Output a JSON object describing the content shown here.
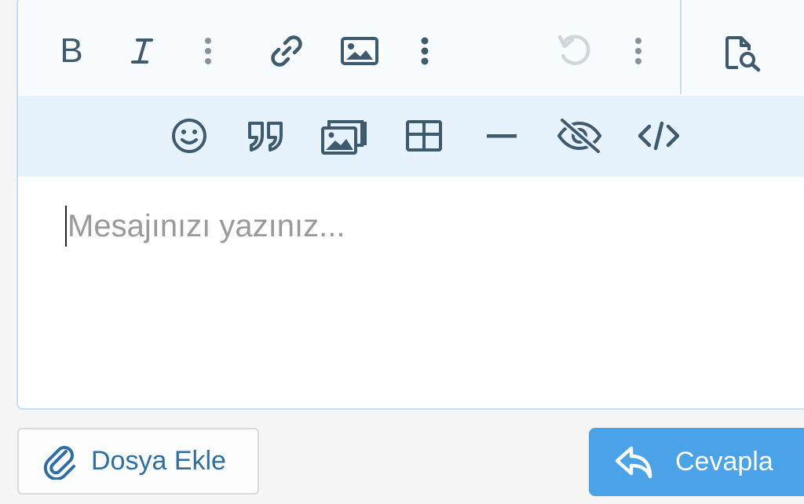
{
  "editor": {
    "placeholder": "Mesajınızı yazınız...",
    "toolbar_top": [
      {
        "name": "bold-icon"
      },
      {
        "name": "italic-icon"
      },
      {
        "name": "more-vertical-icon"
      },
      {
        "name": "link-icon"
      },
      {
        "name": "image-icon"
      },
      {
        "name": "more-vertical-icon"
      },
      {
        "name": "undo-icon"
      },
      {
        "name": "more-vertical-icon"
      },
      {
        "name": "preview-icon"
      }
    ],
    "toolbar_bottom": [
      {
        "name": "smiley-icon"
      },
      {
        "name": "quote-icon"
      },
      {
        "name": "gallery-icon"
      },
      {
        "name": "table-icon"
      },
      {
        "name": "horizontal-rule-icon"
      },
      {
        "name": "spoiler-eye-slash-icon"
      },
      {
        "name": "code-icon"
      }
    ]
  },
  "actions": {
    "attach_label": "Dosya Ekle",
    "reply_label": "Cevapla"
  },
  "colors": {
    "icon": "#3e5a6e",
    "disabled_icon": "#cfd6dc",
    "accent": "#4aa3e6",
    "link": "#2d6fa3"
  }
}
